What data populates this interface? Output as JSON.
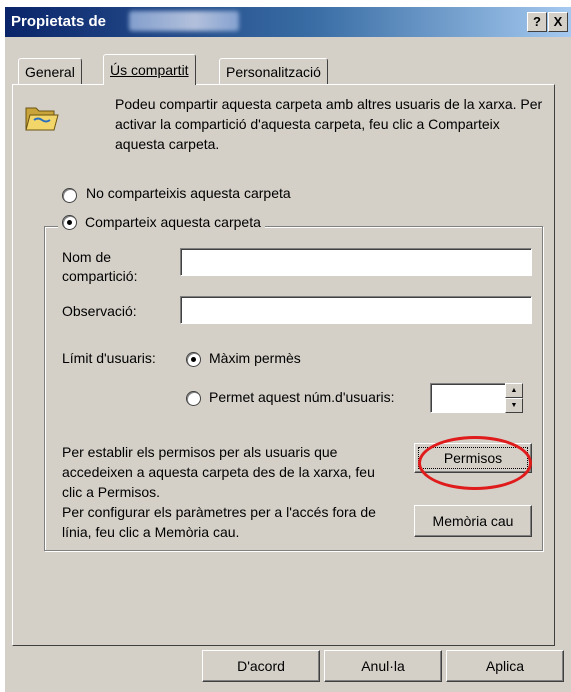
{
  "window": {
    "title": "Propietats de",
    "help_button": "?",
    "close_button": "X"
  },
  "tabs": [
    {
      "label": "General"
    },
    {
      "label": "Ús compartit"
    },
    {
      "label": "Personalització"
    }
  ],
  "intro_text": "Podeu compartir aquesta carpeta amb altres usuaris de la xarxa. Per activar la compartició d'aquesta carpeta, feu clic a Comparteix aquesta carpeta.",
  "share_options": {
    "no_share": "No comparteixis aquesta carpeta",
    "share": "Comparteix aquesta carpeta",
    "selected": "share"
  },
  "fields": {
    "share_name_label": "Nom de compartició:",
    "share_name_value": "",
    "comment_label": "Observació:",
    "comment_value": ""
  },
  "user_limit": {
    "label": "Límit d'usuaris:",
    "max_allowed": "Màxim permès",
    "allow_n": "Permet aquest núm.d'usuaris:",
    "selected": "max_allowed",
    "count_value": ""
  },
  "permissions_text": "Per establir els permisos per als usuaris que accedeixen a aquesta carpeta des de la xarxa, feu clic a Permisos.",
  "offline_text": "Per configurar els paràmetres per a l'accés fora de línia, feu clic a Memòria cau.",
  "buttons": {
    "permissions": "Permisos",
    "cache": "Memòria cau",
    "ok": "D'acord",
    "cancel": "Anul·la",
    "apply": "Aplica"
  },
  "colors": {
    "title_gradient_start": "#0a246a",
    "title_gradient_end": "#a6caf0",
    "face": "#d4d0c8",
    "highlight_circle": "#e01b1b"
  }
}
